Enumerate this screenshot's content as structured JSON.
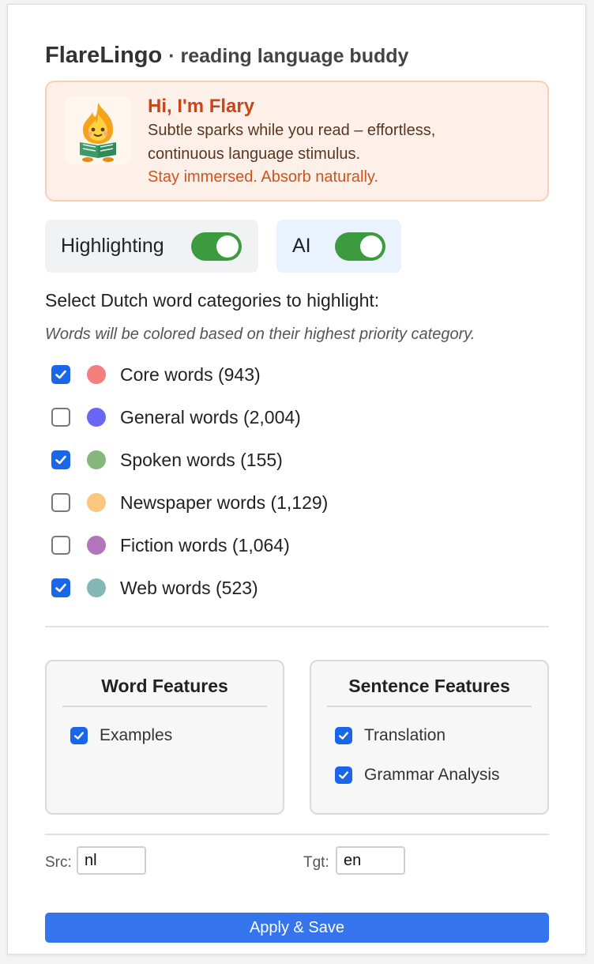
{
  "header": {
    "brand": "FlareLingo",
    "tagline": "· reading language buddy"
  },
  "welcome": {
    "mascot_icon": "flame-reading-mascot-icon",
    "title": "Hi, I'm Flary",
    "description_line1": "Subtle sparks while you read – effortless,",
    "description_line2": "continuous language stimulus.",
    "motto": "Stay immersed. Absorb naturally."
  },
  "toggles": {
    "highlighting": {
      "label": "Highlighting",
      "on": true
    },
    "ai": {
      "label": "AI",
      "on": true
    },
    "on_color": "#3c9b3f"
  },
  "categories": {
    "heading": "Select Dutch word categories to highlight:",
    "note": "Words will be colored based on their highest priority category.",
    "items": [
      {
        "label": "Core words (943)",
        "checked": true,
        "color": "#f57f7f"
      },
      {
        "label": "General words (2,004)",
        "checked": false,
        "color": "#6b66f5"
      },
      {
        "label": "Spoken words (155)",
        "checked": true,
        "color": "#86b87d"
      },
      {
        "label": "Newspaper words (1,129)",
        "checked": false,
        "color": "#fbc77f"
      },
      {
        "label": "Fiction words (1,064)",
        "checked": false,
        "color": "#b275bb"
      },
      {
        "label": "Web words (523)",
        "checked": true,
        "color": "#84b6b4"
      }
    ]
  },
  "word_features": {
    "title": "Word Features",
    "items": [
      {
        "label": "Examples",
        "checked": true
      }
    ]
  },
  "sentence_features": {
    "title": "Sentence Features",
    "items": [
      {
        "label": "Translation",
        "checked": true
      },
      {
        "label": "Grammar Analysis",
        "checked": true
      }
    ]
  },
  "languages": {
    "src_label": "Src:",
    "src_value": "nl",
    "tgt_label": "Tgt:",
    "tgt_value": "en"
  },
  "apply_button": "Apply & Save",
  "colors": {
    "accent": "#1a66e8",
    "button": "#3474ec",
    "welcome_title": "#c8461a"
  }
}
